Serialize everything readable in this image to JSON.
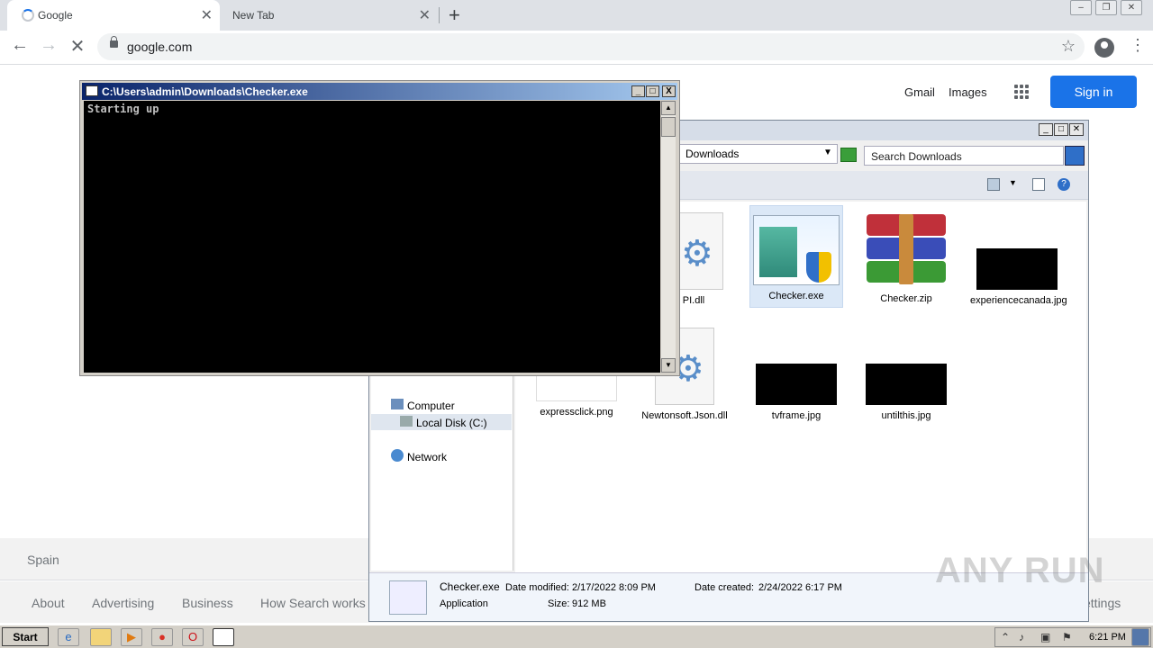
{
  "browser": {
    "tabs": [
      {
        "title": "Google"
      },
      {
        "title": "New Tab"
      }
    ],
    "new_tab_symbol": "+",
    "url": "google.com"
  },
  "google": {
    "links": {
      "gmail": "Gmail",
      "images": "Images"
    },
    "signin": "Sign in",
    "country": "Spain",
    "footer": [
      "About",
      "Advertising",
      "Business",
      "How Search works"
    ],
    "footer_right": "ettings"
  },
  "console": {
    "title": "C:\\Users\\admin\\Downloads\\Checker.exe",
    "output": "Starting up",
    "controls": [
      "_",
      "□",
      "X"
    ]
  },
  "explorer": {
    "breadcrumb": "Downloads",
    "search_placeholder": "Search Downloads",
    "nav": [
      "Computer",
      "Local Disk (C:)",
      "Network"
    ],
    "files": [
      {
        "name": "PI.dll"
      },
      {
        "name": "Checker.exe"
      },
      {
        "name": "Checker.zip"
      },
      {
        "name": "experiencecanada.jpg"
      },
      {
        "name": "expressclick.png"
      },
      {
        "name": "Newtonsoft.Json.dll"
      },
      {
        "name": "tvframe.jpg"
      },
      {
        "name": "untilthis.jpg"
      }
    ],
    "details": {
      "name": "Checker.exe",
      "type": "Application",
      "modified_label": "Date modified:",
      "modified": "2/17/2022 8:09 PM",
      "created_label": "Date created:",
      "created": "2/24/2022 6:17 PM",
      "size_label": "Size:",
      "size": "912 MB"
    }
  },
  "taskbar": {
    "start": "Start",
    "time": "6:21 PM"
  },
  "watermark": "ANY RUN",
  "colors": {
    "accent": "#1a73e8",
    "console_bg": "#000000"
  }
}
